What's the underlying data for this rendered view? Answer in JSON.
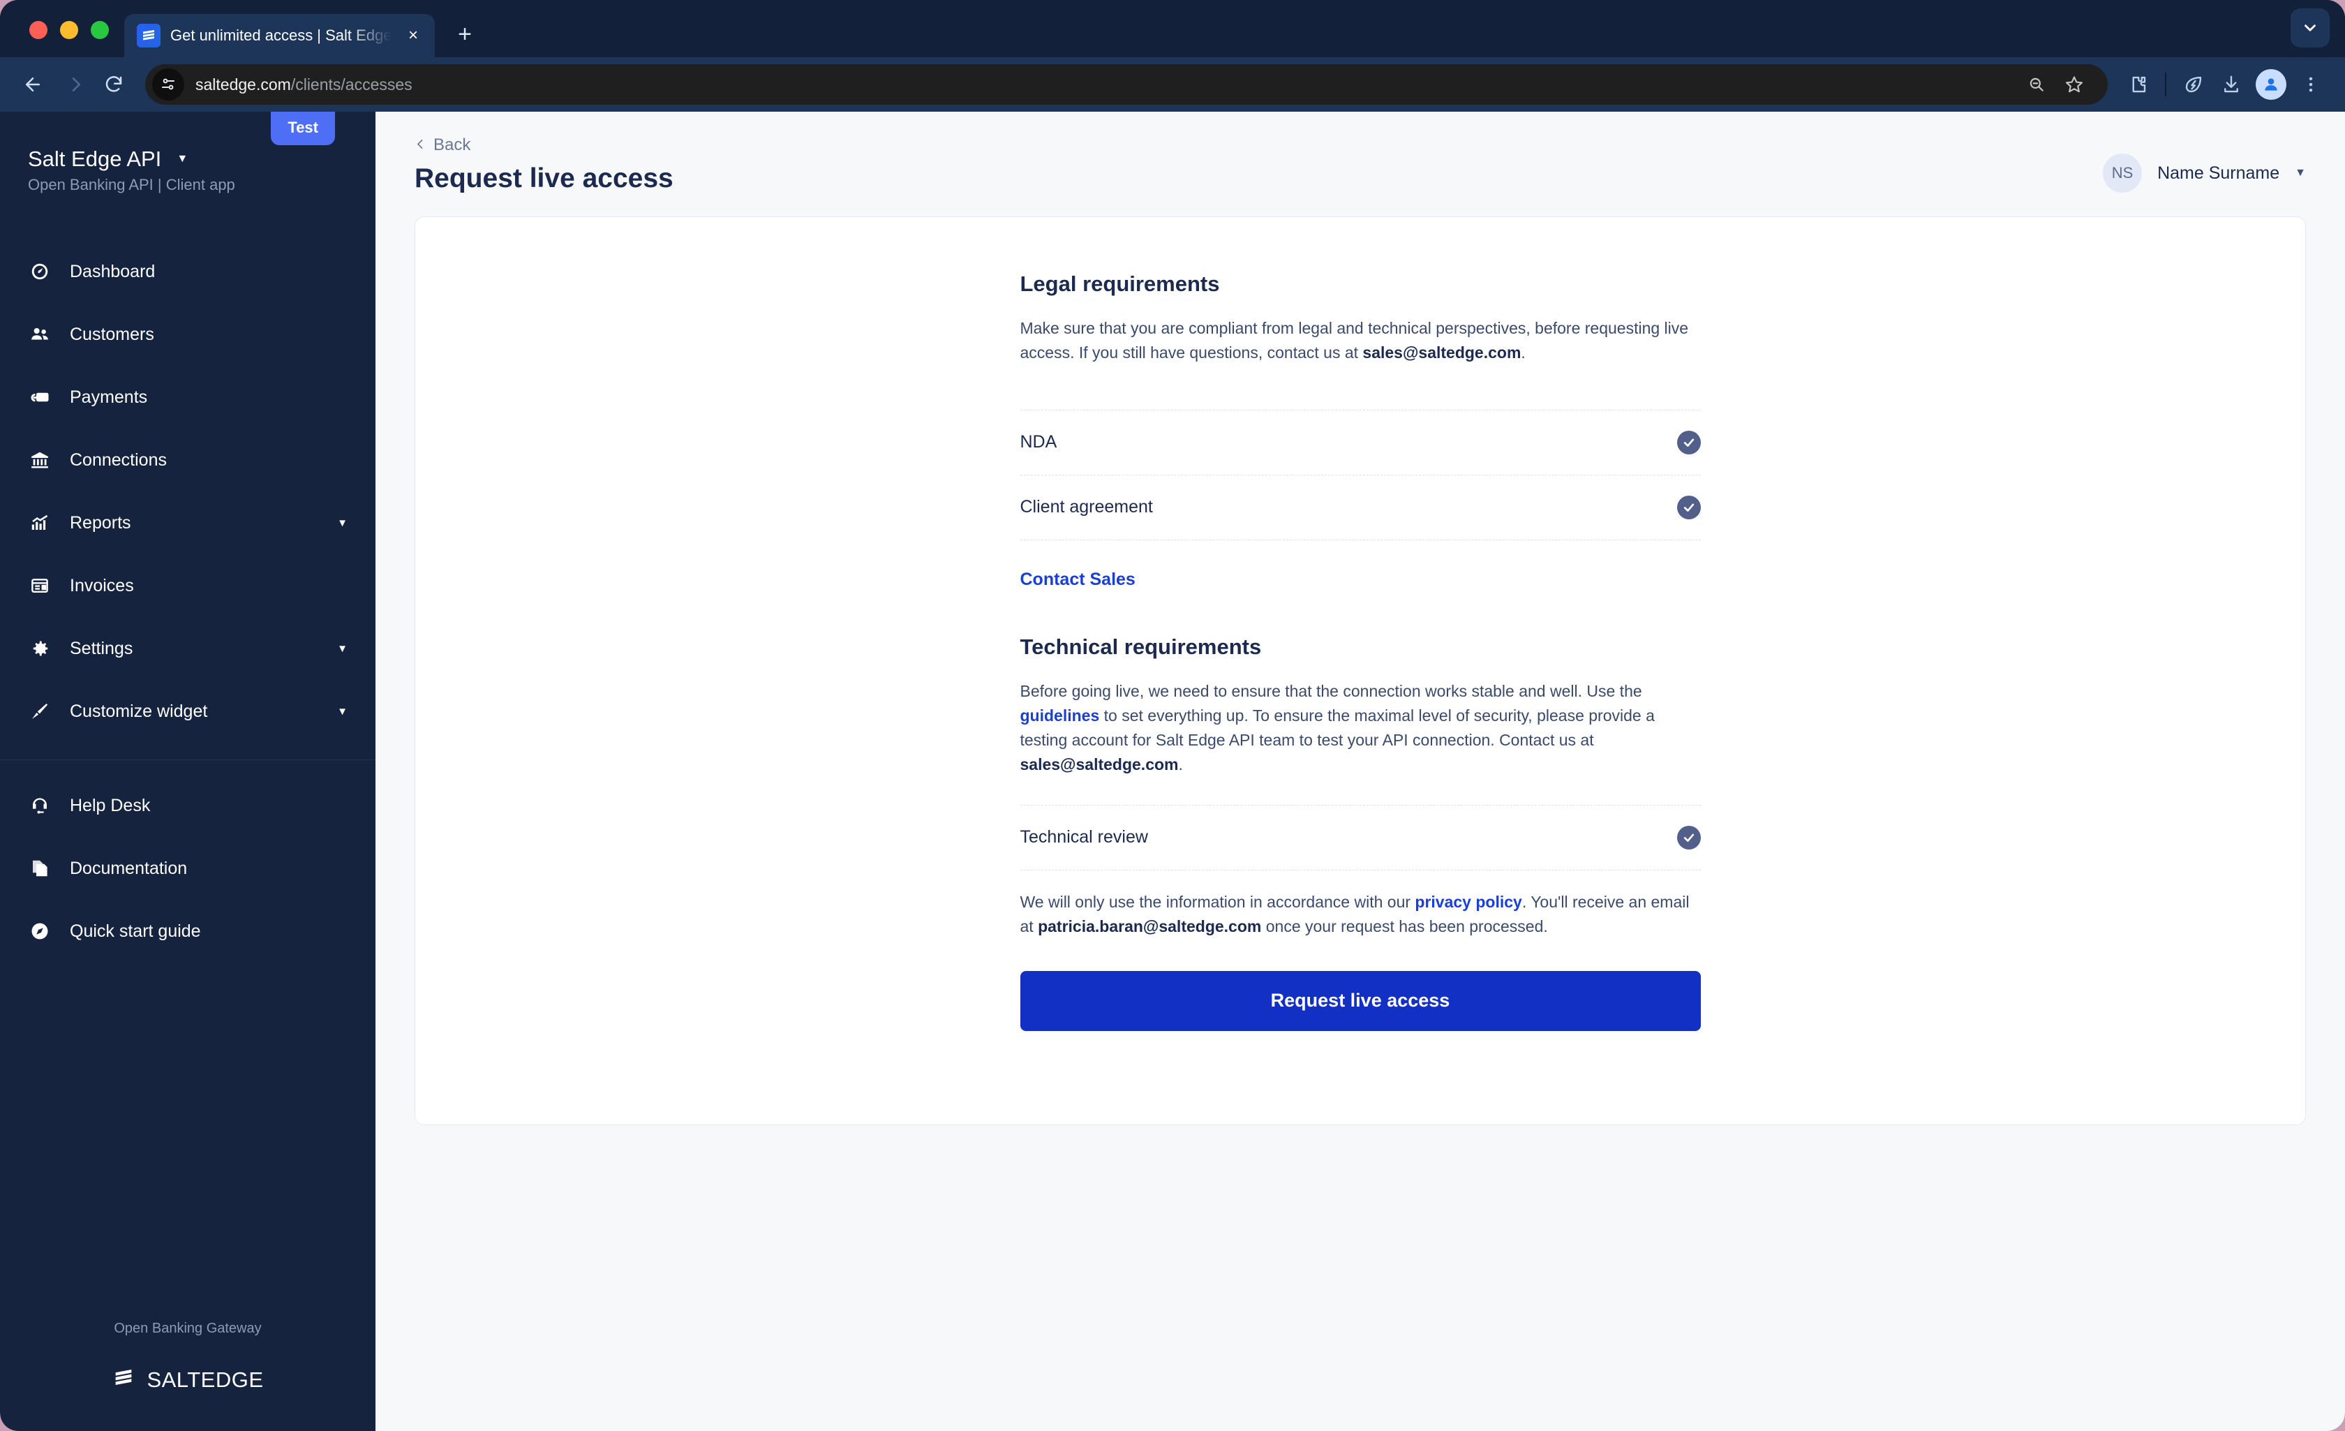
{
  "browser": {
    "tab": {
      "title": "Get unlimited access | Salt Edge",
      "favicon": "saltedge-logo-icon",
      "close": "×"
    },
    "new_tab_label": "+",
    "omnibox": {
      "domain": "saltedge.com",
      "path": "/clients/accesses",
      "site_info_icon": "tune-icon"
    },
    "icons": {
      "back": "back-arrow-icon",
      "forward": "forward-arrow-icon",
      "reload": "reload-icon",
      "zoom_out": "zoom-out-icon",
      "bookmark": "star-icon",
      "extensions": "extensions-puzzle-icon",
      "eco": "leaf-performance-icon",
      "downloads": "download-icon",
      "profile": "profile-avatar-icon",
      "menu": "three-dot-menu-icon",
      "window_chevron": "chevron-down-icon"
    }
  },
  "sidebar": {
    "badge": "Test",
    "brand": {
      "name": "Salt Edge API",
      "subtitle": "Open Banking API | Client app",
      "caret": "▼"
    },
    "items": [
      {
        "label": "Dashboard",
        "icon": "gauge-icon",
        "has_caret": false
      },
      {
        "label": "Customers",
        "icon": "people-icon",
        "has_caret": false
      },
      {
        "label": "Payments",
        "icon": "payments-card-icon",
        "has_caret": false
      },
      {
        "label": "Connections",
        "icon": "bank-icon",
        "has_caret": false
      },
      {
        "label": "Reports",
        "icon": "chart-up-icon",
        "has_caret": true
      },
      {
        "label": "Invoices",
        "icon": "invoice-icon",
        "has_caret": false
      },
      {
        "label": "Settings",
        "icon": "gear-icon",
        "has_caret": true
      },
      {
        "label": "Customize widget",
        "icon": "brush-icon",
        "has_caret": true
      }
    ],
    "secondary_items": [
      {
        "label": "Help Desk",
        "icon": "headset-icon"
      },
      {
        "label": "Documentation",
        "icon": "documents-icon"
      },
      {
        "label": "Quick start guide",
        "icon": "compass-icon"
      }
    ],
    "footer": {
      "text": "Open Banking Gateway",
      "logo_name": "SALTEDGE",
      "logo_icon": "saltedge-mark-icon"
    },
    "caret_glyph": "▼"
  },
  "header": {
    "back_label": "Back",
    "back_icon": "chevron-left-icon",
    "title": "Request live access",
    "user": {
      "initials": "NS",
      "name": "Name Surname",
      "caret": "▼"
    }
  },
  "content": {
    "legal": {
      "title": "Legal requirements",
      "body_pre": "Make sure that you are compliant from legal and technical perspectives, before requesting live access. If you still have questions, contact us at ",
      "body_email": "sales@saltedge.com",
      "body_post": ".",
      "rows": [
        {
          "label": "NDA",
          "status": "check-circle-icon"
        },
        {
          "label": "Client agreement",
          "status": "check-circle-icon"
        }
      ],
      "contact_sales": "Contact Sales"
    },
    "technical": {
      "title": "Technical requirements",
      "body_a": "Before going live, we need to ensure that the connection works stable and well. Use the ",
      "body_link": "guidelines",
      "body_b": " to set everything up. To ensure the maximal level of security, please provide a testing account for Salt Edge API team to test your API connection. Contact us at ",
      "body_email": "sales@saltedge.com",
      "body_c": ".",
      "rows": [
        {
          "label": "Technical review",
          "status": "check-circle-icon"
        }
      ]
    },
    "notice": {
      "pre": "We will only use the information in accordance with our ",
      "link": "privacy policy",
      "mid": ". You'll receive an email at ",
      "email": "patricia.baran@saltedge.com",
      "post": " once your request has been processed."
    },
    "cta_label": "Request live access"
  },
  "colors": {
    "sidebar_bg": "#16233f",
    "accent_blue": "#1330c4",
    "link_blue": "#1a3fd4",
    "badge_blue": "#4d6ef5",
    "check_circle": "#525f8a",
    "page_bg": "#f7f8fa"
  }
}
